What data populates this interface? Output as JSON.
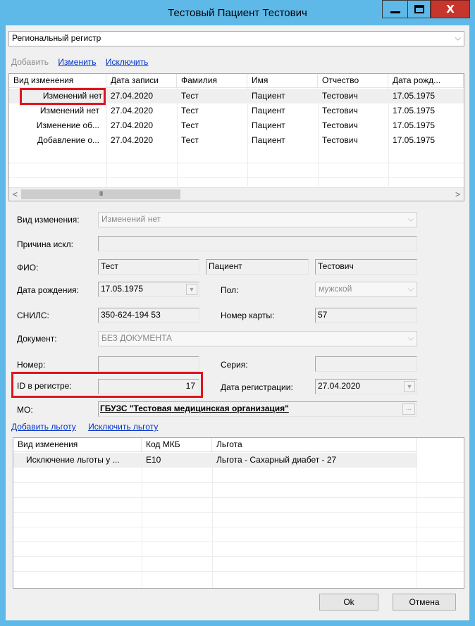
{
  "window": {
    "title": "Тестовый Пациент Тестович",
    "close_glyph": "X"
  },
  "register_select": {
    "value": "Региональный регистр"
  },
  "toolbar": {
    "add_label": "Добавить",
    "edit_label": "Изменить",
    "exclude_label": "Исключить"
  },
  "history_table": {
    "columns": [
      "Вид изменения",
      "Дата записи",
      "Фамилия",
      "Имя",
      "Отчество",
      "Дата рожд..."
    ],
    "rows": [
      [
        "Изменений нет",
        "27.04.2020",
        "Тест",
        "Пациент",
        "Тестович",
        "17.05.1975"
      ],
      [
        "Изменений нет",
        "27.04.2020",
        "Тест",
        "Пациент",
        "Тестович",
        "17.05.1975"
      ],
      [
        "Изменение об...",
        "27.04.2020",
        "Тест",
        "Пациент",
        "Тестович",
        "17.05.1975"
      ],
      [
        "Добавление о...",
        "27.04.2020",
        "Тест",
        "Пациент",
        "Тестович",
        "17.05.1975"
      ]
    ],
    "scroll_left": "<",
    "scroll_right": ">",
    "scroll_thumb": "III"
  },
  "form": {
    "change_type": {
      "label": "Вид изменения:",
      "value": "Изменений нет"
    },
    "exclusion_reason": {
      "label": "Причина искл:",
      "value": ""
    },
    "fio": {
      "label": "ФИО:",
      "last": "Тест",
      "first": "Пациент",
      "middle": "Тестович"
    },
    "birth_date": {
      "label": "Дата рождения:",
      "value": "17.05.1975"
    },
    "gender": {
      "label": "Пол:",
      "value": "мужской"
    },
    "snils": {
      "label": "СНИЛС:",
      "value": "350-624-194 53"
    },
    "card_number": {
      "label": "Номер карты:",
      "value": "57"
    },
    "document": {
      "label": "Документ:",
      "value": "БЕЗ ДОКУМЕНТА"
    },
    "number": {
      "label": "Номер:",
      "value": ""
    },
    "series": {
      "label": "Серия:",
      "value": ""
    },
    "registry_id": {
      "label": "ID в регистре:",
      "value": "17"
    },
    "registration_date": {
      "label": "Дата регистрации:",
      "value": "27.04.2020"
    },
    "mo": {
      "label": "МО:",
      "value": "ГБУЗС \"Тестовая медицинская организация\"",
      "button": "..."
    }
  },
  "benefit_actions": {
    "add_label": "Добавить льготу",
    "exclude_label": "Исключить льготу"
  },
  "benefits_table": {
    "columns": [
      "Вид изменения",
      "Код МКБ",
      "Льгота"
    ],
    "rows": [
      [
        "Исключение льготы у ...",
        "E10",
        "Льгота - Сахарный диабет - 27"
      ]
    ]
  },
  "buttons": {
    "ok": "Ok",
    "cancel": "Отмена"
  },
  "colors": {
    "titlebar": "#5fb9e8",
    "close": "#c7362d",
    "highlight": "#e0141e",
    "link": "#0033cc"
  }
}
